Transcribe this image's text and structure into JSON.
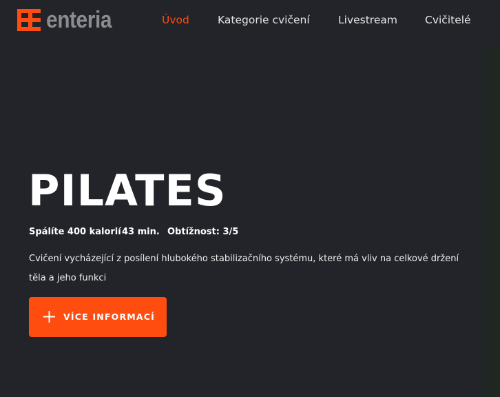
{
  "brand": {
    "name": "enteria",
    "logo_icon": "enteria-logo-icon",
    "logo_color": "#ff4d12",
    "text_color": "#8b8c8f"
  },
  "nav": {
    "items": [
      {
        "label": "Úvod",
        "active": true
      },
      {
        "label": "Kategorie cvičení",
        "active": false
      },
      {
        "label": "Livestream",
        "active": false
      },
      {
        "label": "Cvičitelé",
        "active": false
      }
    ]
  },
  "hero": {
    "title": "PILATES",
    "meta": {
      "calories": "Spálíte 400 kalorií",
      "duration": "43 min.",
      "difficulty": "Obtížnost: 3/5"
    },
    "description": "Cvičení vycházející z posílení hlubokého stabilizačního systému, které má vliv na celkové držení těla a jeho funkci",
    "cta": {
      "label": "VÍCE INFORMACÍ",
      "icon": "plus-icon"
    }
  },
  "colors": {
    "background": "#222429",
    "accent": "#ff4d0f",
    "text": "#ffffff"
  }
}
